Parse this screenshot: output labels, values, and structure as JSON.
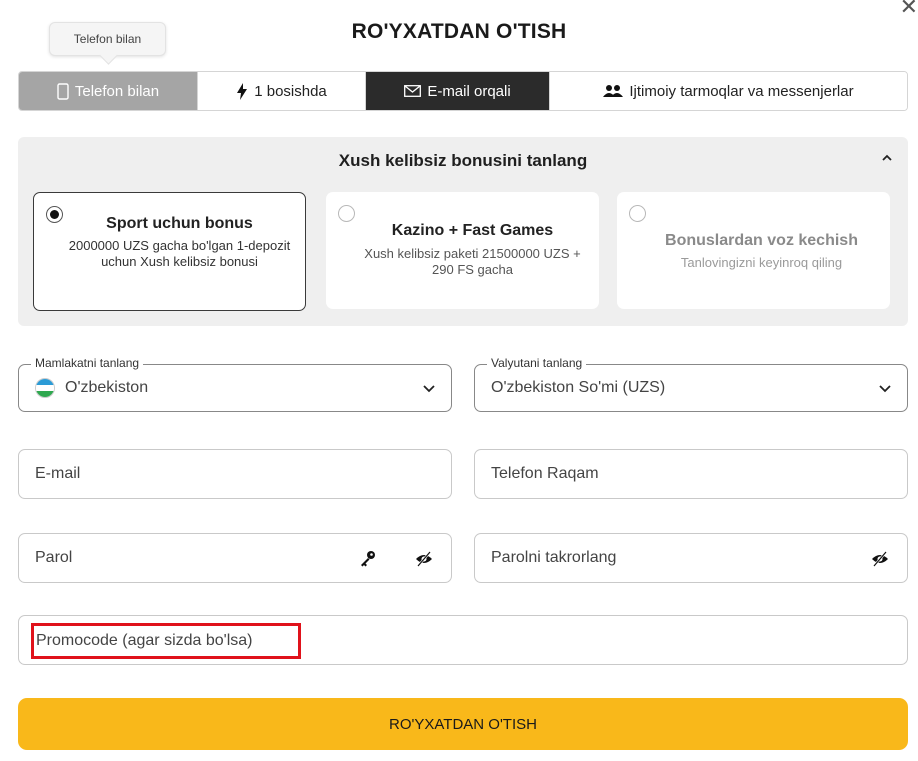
{
  "title": "RO'YXATDAN O'TISH",
  "tooltip": "Telefon bilan",
  "tabs": [
    {
      "label": "Telefon bilan",
      "icon": "phone-icon"
    },
    {
      "label": "1 bosishda",
      "icon": "lightning-icon"
    },
    {
      "label": "E-mail orqali",
      "icon": "envelope-icon"
    },
    {
      "label": "Ijtimoiy tarmoqlar va messenjerlar",
      "icon": "users-icon"
    }
  ],
  "bonus": {
    "heading": "Xush kelibsiz bonusini tanlang",
    "options": [
      {
        "title": "Sport uchun bonus",
        "desc": "2000000 UZS gacha bo'lgan 1-depozit uchun Xush kelibsiz bonusi",
        "selected": true
      },
      {
        "title": "Kazino + Fast Games",
        "desc": "Xush kelibsiz paketi 21500000 UZS + 290 FS gacha",
        "selected": false
      },
      {
        "title": "Bonuslardan voz kechish",
        "desc": "Tanlovingizni keyinroq qiling",
        "selected": false
      }
    ]
  },
  "form": {
    "country_legend": "Mamlakatni tanlang",
    "country_value": "O'zbekiston",
    "currency_legend": "Valyutani tanlang",
    "currency_value": "O'zbekiston So'mi (UZS)",
    "email_placeholder": "E-mail",
    "phone_placeholder": "Telefon Raqam",
    "password_placeholder": "Parol",
    "password_repeat_placeholder": "Parolni takrorlang",
    "promo_placeholder": "Promocode (agar sizda bo'lsa)"
  },
  "submit_label": "RO'YXATDAN O'TISH",
  "colors": {
    "accent": "#f9b81a",
    "active_tab": "#2b2b2b",
    "hovered_tab": "#a5a5a5",
    "highlight": "#e0121b"
  }
}
